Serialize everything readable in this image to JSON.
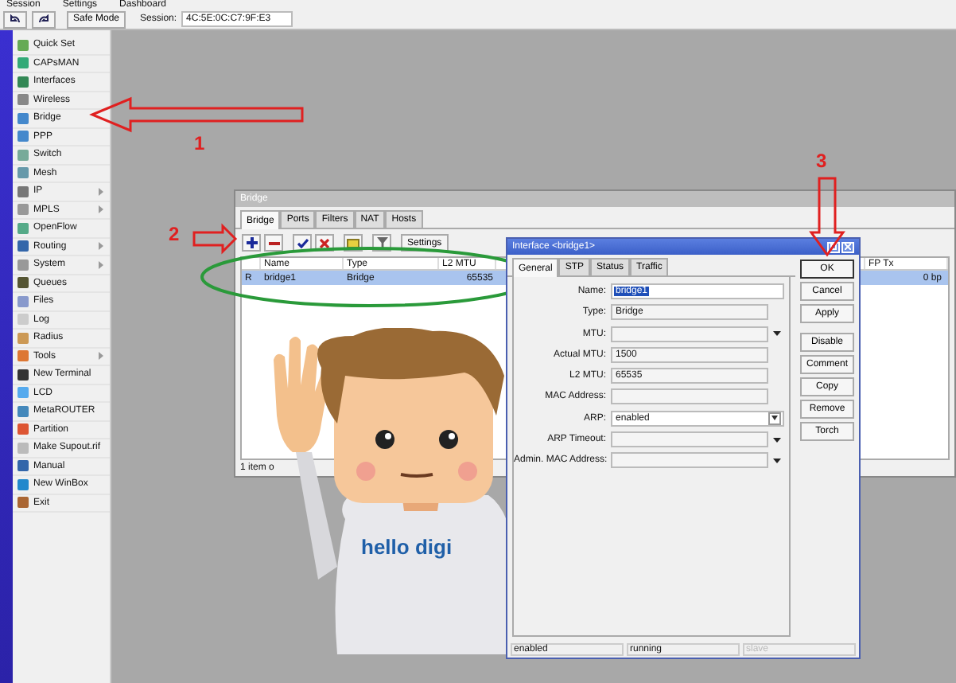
{
  "menu_bar": [
    "Session",
    "Settings",
    "Dashboard"
  ],
  "toolbar": {
    "safe_mode": "Safe Mode",
    "session_label": "Session:",
    "session_value": "4C:5E:0C:C7:9F:E3"
  },
  "sidebar": {
    "items": [
      {
        "label": "Quick Set",
        "submenu": false
      },
      {
        "label": "CAPsMAN",
        "submenu": false
      },
      {
        "label": "Interfaces",
        "submenu": false
      },
      {
        "label": "Wireless",
        "submenu": false
      },
      {
        "label": "Bridge",
        "submenu": false
      },
      {
        "label": "PPP",
        "submenu": false
      },
      {
        "label": "Switch",
        "submenu": false
      },
      {
        "label": "Mesh",
        "submenu": false
      },
      {
        "label": "IP",
        "submenu": true
      },
      {
        "label": "MPLS",
        "submenu": true
      },
      {
        "label": "OpenFlow",
        "submenu": false
      },
      {
        "label": "Routing",
        "submenu": true
      },
      {
        "label": "System",
        "submenu": true
      },
      {
        "label": "Queues",
        "submenu": false
      },
      {
        "label": "Files",
        "submenu": false
      },
      {
        "label": "Log",
        "submenu": false
      },
      {
        "label": "Radius",
        "submenu": false
      },
      {
        "label": "Tools",
        "submenu": true
      },
      {
        "label": "New Terminal",
        "submenu": false
      },
      {
        "label": "LCD",
        "submenu": false
      },
      {
        "label": "MetaROUTER",
        "submenu": false
      },
      {
        "label": "Partition",
        "submenu": false
      },
      {
        "label": "Make Supout.rif",
        "submenu": false
      },
      {
        "label": "Manual",
        "submenu": false
      },
      {
        "label": "New WinBox",
        "submenu": false
      },
      {
        "label": "Exit",
        "submenu": false
      }
    ]
  },
  "bridge_window": {
    "title": "Bridge",
    "tabs": [
      {
        "label": "Bridge",
        "selected": true
      },
      {
        "label": "Ports",
        "selected": false
      },
      {
        "label": "Filters",
        "selected": false
      },
      {
        "label": "NAT",
        "selected": false
      },
      {
        "label": "Hosts",
        "selected": false
      }
    ],
    "settings_button": "Settings",
    "columns": [
      "Name",
      "Type",
      "L2 MTU",
      "FP Tx"
    ],
    "rows": [
      {
        "flag": "R",
        "name": "bridge1",
        "type": "Bridge",
        "l2_mtu": "65535",
        "fp_tx": "0 bp",
        "selected": true
      }
    ],
    "status": "1 item o"
  },
  "interface_dialog": {
    "title": "Interface <bridge1>",
    "tabs": [
      {
        "label": "General",
        "selected": true
      },
      {
        "label": "STP",
        "selected": false
      },
      {
        "label": "Status",
        "selected": false
      },
      {
        "label": "Traffic",
        "selected": false
      }
    ],
    "fields": [
      {
        "label": "Name:",
        "value": "bridge1",
        "kind": "text",
        "highlighted": true
      },
      {
        "label": "Type:",
        "value": "Bridge",
        "kind": "readonly"
      },
      {
        "label": "MTU:",
        "kind": "dropdown"
      },
      {
        "label": "Actual MTU:",
        "value": "1500",
        "kind": "readonly"
      },
      {
        "label": "L2 MTU:",
        "value": "65535",
        "kind": "readonly"
      },
      {
        "label": "MAC Address:",
        "kind": "readonly"
      },
      {
        "label": "ARP:",
        "value": "enabled",
        "kind": "select"
      },
      {
        "label": "ARP Timeout:",
        "kind": "dropdown"
      },
      {
        "label": "Admin. MAC Address:",
        "kind": "dropdown"
      }
    ],
    "button_groups": [
      [
        {
          "label": "OK",
          "focused": true
        },
        {
          "label": "Cancel",
          "focused": false
        },
        {
          "label": "Apply",
          "focused": false
        }
      ],
      [
        {
          "label": "Disable",
          "focused": false
        },
        {
          "label": "Comment",
          "focused": false
        },
        {
          "label": "Copy",
          "focused": false
        },
        {
          "label": "Remove",
          "focused": false
        },
        {
          "label": "Torch",
          "focused": false
        }
      ]
    ],
    "status": [
      {
        "text": "enabled",
        "disabled": false
      },
      {
        "text": "running",
        "disabled": false
      },
      {
        "text": "slave",
        "disabled": true
      }
    ]
  },
  "illustration": {
    "shirt_text": "hello digi"
  },
  "annotations": [
    {
      "label": "1"
    },
    {
      "label": "2"
    },
    {
      "label": "3"
    }
  ]
}
